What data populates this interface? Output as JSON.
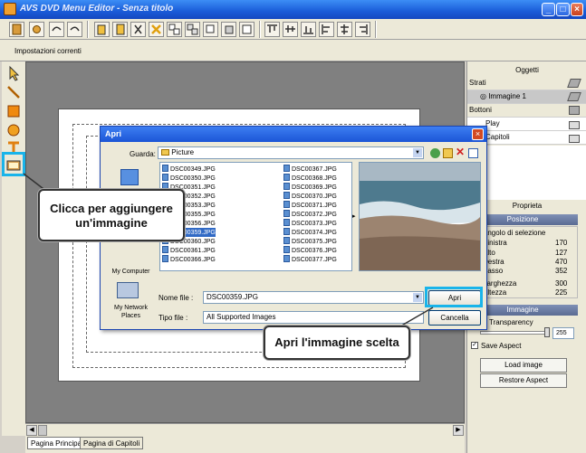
{
  "window": {
    "title": "AVS DVD Menu Editor - Senza titolo"
  },
  "top_tab": {
    "label": "Impostazioni correnti"
  },
  "bottom_tabs": [
    "Pagina Principale",
    "Pagina di Capitoli"
  ],
  "right_panel": {
    "objects_header": "Oggetti",
    "layers_label": "Strati",
    "layer_item": "Immagine 1",
    "buttons_label": "Bottoni",
    "button_items": [
      "Play",
      "Capitoli"
    ],
    "properties_header": "Proprieta",
    "position_section": "Posizione",
    "rect_label": "Angolo di selezione",
    "props": [
      {
        "label": "Sinistra",
        "value": "170"
      },
      {
        "label": "Alto",
        "value": "127"
      },
      {
        "label": "Destra",
        "value": "470"
      },
      {
        "label": "Basso",
        "value": "352"
      },
      {
        "label": "Larghezza",
        "value": "300"
      },
      {
        "label": "Altezza",
        "value": "225"
      }
    ],
    "image_section": "Immagine",
    "transparency_label": "Transparency",
    "transparency_value": "255",
    "save_aspect_label": "Save Aspect",
    "load_image_btn": "Load image",
    "restore_aspect_btn": "Restore Aspect"
  },
  "dialog": {
    "title": "Apri",
    "look_in_label": "Guarda:",
    "look_in_value": "Picture",
    "places": [
      "My Computer",
      "My Network Places"
    ],
    "files_col1": [
      "DSC00349.JPG",
      "DSC00350.JPG",
      "DSC00351.JPG",
      "DSC00352.JPG",
      "DSC00353.JPG",
      "DSC00355.JPG",
      "DSC00356.JPG",
      "DSC00359.JPG",
      "DSC00360.JPG",
      "DSC00361.JPG",
      "DSC00366.JPG"
    ],
    "files_col2": [
      "DSC00367.JPG",
      "DSC00368.JPG",
      "DSC00369.JPG",
      "DSC00370.JPG",
      "DSC00371.JPG",
      "DSC00372.JPG",
      "DSC00373.JPG",
      "DSC00374.JPG",
      "DSC00375.JPG",
      "DSC00376.JPG",
      "DSC00377.JPG"
    ],
    "selected_file": "DSC00359.JPG",
    "filename_label": "Nome file :",
    "filename_value": "DSC00359.JPG",
    "filetype_label": "Tipo file :",
    "filetype_value": "All Supported Images",
    "open_btn": "Apri",
    "cancel_btn": "Cancella"
  },
  "callouts": {
    "add_image": "Clicca per aggiungere un'immagine",
    "open_image": "Apri l'immagine scelta"
  },
  "colors": {
    "highlight": "#19b4ea",
    "titlebar": "#1a5bd8"
  }
}
